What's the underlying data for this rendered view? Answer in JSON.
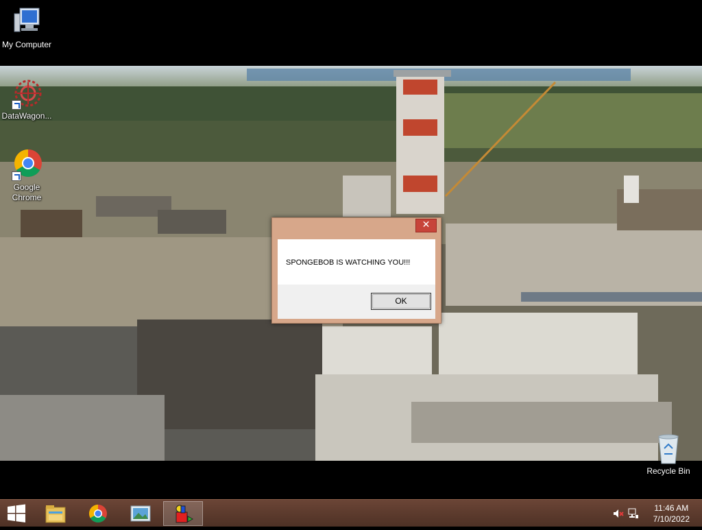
{
  "desktop": {
    "icons": [
      {
        "label": "My Computer",
        "icon": "computer-icon"
      },
      {
        "label": "DataWagon...",
        "icon": "datawagon-icon"
      },
      {
        "label": "Google Chrome",
        "icon": "chrome-icon"
      },
      {
        "label": "Recycle Bin",
        "icon": "recycle-bin-icon"
      }
    ]
  },
  "dialog": {
    "message": "SPONGEBOB IS WATCHING YOU!!!",
    "close_symbol": "✕",
    "ok_label": "OK"
  },
  "taskbar": {
    "items": [
      {
        "name": "start",
        "icon": "windows-logo-icon"
      },
      {
        "name": "file-explorer",
        "icon": "folder-icon"
      },
      {
        "name": "google-chrome",
        "icon": "chrome-icon"
      },
      {
        "name": "photo-viewer",
        "icon": "photo-icon"
      },
      {
        "name": "shapes-app",
        "icon": "shapes-icon",
        "active": true
      }
    ],
    "tray": {
      "volume_icon": "volume-muted-icon",
      "network_icon": "network-icon",
      "time": "11:46 AM",
      "date": "7/10/2022"
    }
  },
  "colors": {
    "taskbar": "#5a3a2c",
    "dialog_frame": "#d7a78a",
    "close_button": "#c7443a"
  }
}
